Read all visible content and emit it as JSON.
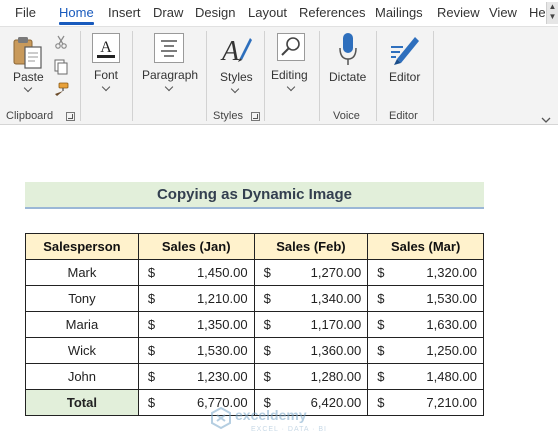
{
  "menu": {
    "tabs": [
      {
        "label": "File"
      },
      {
        "label": "Home"
      },
      {
        "label": "Insert"
      },
      {
        "label": "Draw"
      },
      {
        "label": "Design"
      },
      {
        "label": "Layout"
      },
      {
        "label": "References"
      },
      {
        "label": "Mailings"
      },
      {
        "label": "Review"
      },
      {
        "label": "View"
      },
      {
        "label": "Hel"
      }
    ],
    "active_tab": "Home",
    "accent_color": "#185abd"
  },
  "ribbon": {
    "clipboard": {
      "paste_label": "Paste",
      "group_label": "Clipboard"
    },
    "font": {
      "label": "Font"
    },
    "paragraph": {
      "label": "Paragraph"
    },
    "styles": {
      "styles_label": "Styles",
      "group_label": "Styles"
    },
    "editing": {
      "label": "Editing"
    },
    "voice": {
      "dictate_label": "Dictate",
      "group_label": "Voice"
    },
    "editor": {
      "editor_label": "Editor",
      "group_label": "Editor"
    }
  },
  "document": {
    "title": "Copying as Dynamic Image",
    "table": {
      "headers": [
        "Salesperson",
        "Sales (Jan)",
        "Sales (Feb)",
        "Sales (Mar)"
      ],
      "currency_symbol": "$",
      "rows": [
        {
          "name": "Mark",
          "jan": "1,450.00",
          "feb": "1,270.00",
          "mar": "1,320.00"
        },
        {
          "name": "Tony",
          "jan": "1,210.00",
          "feb": "1,340.00",
          "mar": "1,530.00"
        },
        {
          "name": "Maria",
          "jan": "1,350.00",
          "feb": "1,170.00",
          "mar": "1,630.00"
        },
        {
          "name": "Wick",
          "jan": "1,530.00",
          "feb": "1,360.00",
          "mar": "1,250.00"
        },
        {
          "name": "John",
          "jan": "1,230.00",
          "feb": "1,280.00",
          "mar": "1,480.00"
        }
      ],
      "total": {
        "label": "Total",
        "jan": "6,770.00",
        "feb": "6,420.00",
        "mar": "7,210.00"
      }
    },
    "header_fill": "#fff2cc",
    "title_fill": "#e2efda"
  },
  "watermark": {
    "name": "exceldemy",
    "tagline": "EXCEL · DATA · BI"
  }
}
